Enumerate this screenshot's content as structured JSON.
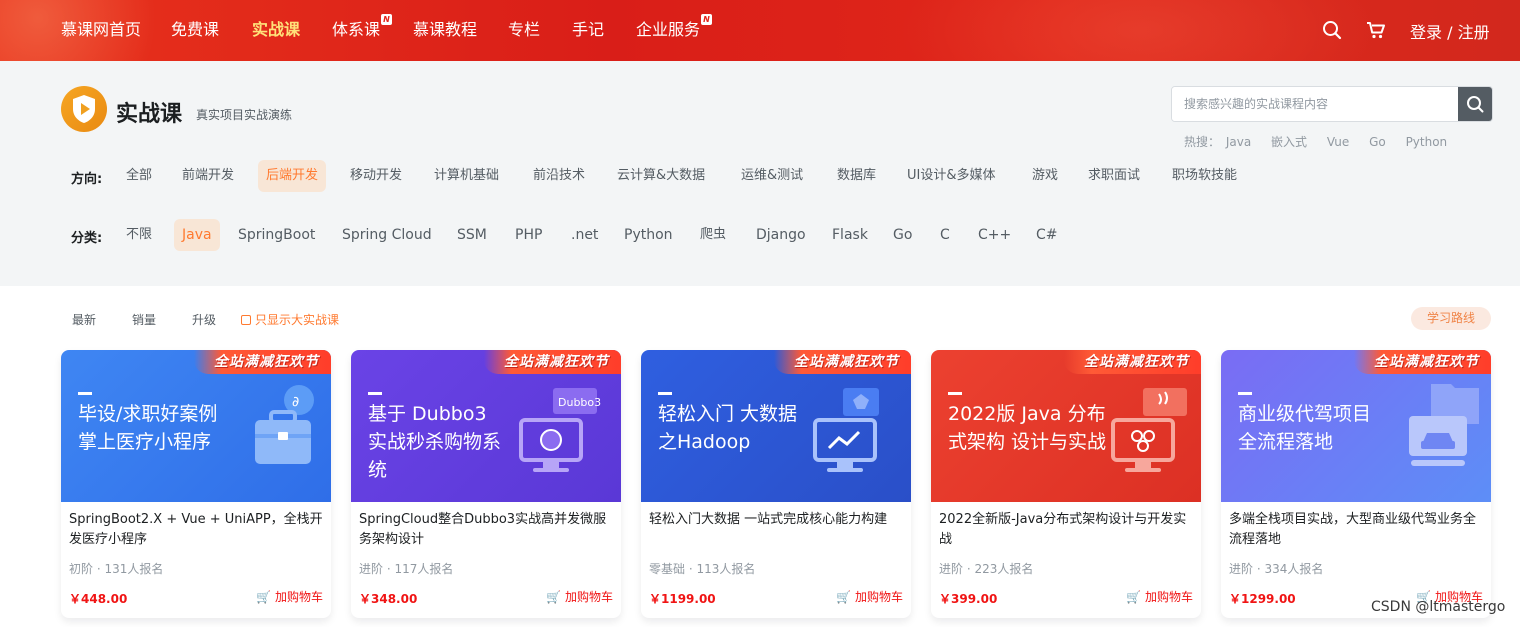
{
  "nav": {
    "items": [
      {
        "label": "慕课网首页",
        "active": false,
        "new": false
      },
      {
        "label": "免费课",
        "active": false,
        "new": false
      },
      {
        "label": "实战课",
        "active": true,
        "new": false
      },
      {
        "label": "体系课",
        "active": false,
        "new": true
      },
      {
        "label": "慕课教程",
        "active": false,
        "new": false
      },
      {
        "label": "专栏",
        "active": false,
        "new": false
      },
      {
        "label": "手记",
        "active": false,
        "new": false
      },
      {
        "label": "企业服务",
        "active": false,
        "new": true
      }
    ],
    "new_badge": "N",
    "login": "登录 / 注册",
    "brand_color": "#e3261c"
  },
  "header": {
    "title": "实战课",
    "subtitle": "真实项目实战演练",
    "search_placeholder": "搜索感兴趣的实战课程内容",
    "hot_label": "热搜：",
    "hot_words": [
      "Java",
      "嵌入式",
      "Vue",
      "Go",
      "Python"
    ]
  },
  "direction": {
    "label": "方向:",
    "options": [
      "全部",
      "前端开发",
      "后端开发",
      "移动开发",
      "计算机基础",
      "前沿技术",
      "云计算&大数据",
      "运维&测试",
      "数据库",
      "UI设计&多媒体",
      "游戏",
      "求职面试",
      "职场软技能"
    ],
    "selected": "后端开发"
  },
  "category": {
    "label": "分类:",
    "options": [
      "不限",
      "Java",
      "SpringBoot",
      "Spring Cloud",
      "SSM",
      "PHP",
      ".net",
      "Python",
      "爬虫",
      "Django",
      "Flask",
      "Go",
      "C",
      "C++",
      "C#"
    ],
    "selected": "Java"
  },
  "sort": {
    "options": [
      "最新",
      "销量",
      "升级"
    ],
    "only_big": "只显示大实战课",
    "route_button": "学习路线"
  },
  "courses": [
    {
      "promo": "全站满减狂欢节",
      "cover_title": "毕设/求职好案例 掌上医疗小程序",
      "title": "SpringBoot2.X + Vue + UniAPP，全栈开发医疗小程序",
      "meta": "初阶 · 131人报名",
      "price": "￥448.00",
      "cart": "加购物车",
      "bg": "#3b7ef0"
    },
    {
      "promo": "全站满减狂欢节",
      "cover_title": "基于 Dubbo3 实战秒杀购物系统",
      "title": "SpringCloud整合Dubbo3实战高并发微服务架构设计",
      "meta": "进阶 · 117人报名",
      "price": "￥348.00",
      "cart": "加购物车",
      "bg": "#6a42e0"
    },
    {
      "promo": "全站满减狂欢节",
      "cover_title": "轻松入门 大数据之Hadoop",
      "title": "轻松入门大数据 一站式完成核心能力构建",
      "meta": "零基础 · 113人报名",
      "price": "￥1199.00",
      "cart": "加购物车",
      "bg": "#2f59d8"
    },
    {
      "promo": "全站满减狂欢节",
      "cover_title": "2022版 Java 分布式架构 设计与实战",
      "title": "2022全新版-Java分布式架构设计与开发实战",
      "meta": "进阶 · 223人报名",
      "price": "￥399.00",
      "cart": "加购物车",
      "bg": "#e2392b"
    },
    {
      "promo": "全站满减狂欢节",
      "cover_title": "商业级代驾项目 全流程落地",
      "title": "多端全栈项目实战，大型商业级代驾业务全流程落地",
      "meta": "进阶 · 334人报名",
      "price": "￥1299.00",
      "cart": "加购物车",
      "bg": "#6f7cf5"
    }
  ],
  "watermark": "CSDN @ltmastergo"
}
